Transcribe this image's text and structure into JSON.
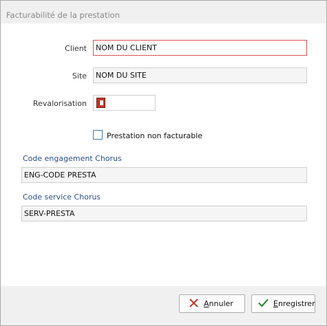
{
  "window": {
    "title": "Facturabilité de la prestation"
  },
  "form": {
    "client": {
      "label": "Client",
      "value": "NOM DU CLIENT"
    },
    "site": {
      "label": "Site",
      "value": "NOM DU SITE"
    },
    "revalorisation": {
      "label": "Revalorisation",
      "icon": "index-icon"
    },
    "non_facturable": {
      "label": "Prestation non facturable",
      "checked": false
    },
    "code_engagement": {
      "label": "Code engagement Chorus",
      "value": "ENG-CODE PRESTA"
    },
    "code_service": {
      "label": "Code service Chorus",
      "value": "SERV-PRESTA"
    }
  },
  "footer": {
    "cancel": {
      "first_letter": "A",
      "rest": "nnuler",
      "icon": "close-icon"
    },
    "save": {
      "first_letter": "E",
      "rest": "nregistrer",
      "icon": "check-icon"
    }
  },
  "colors": {
    "client_border": "#d9534f",
    "section_label": "#2a4f8a",
    "cancel_icon": "#c0392b",
    "save_icon": "#2e8b3a"
  }
}
